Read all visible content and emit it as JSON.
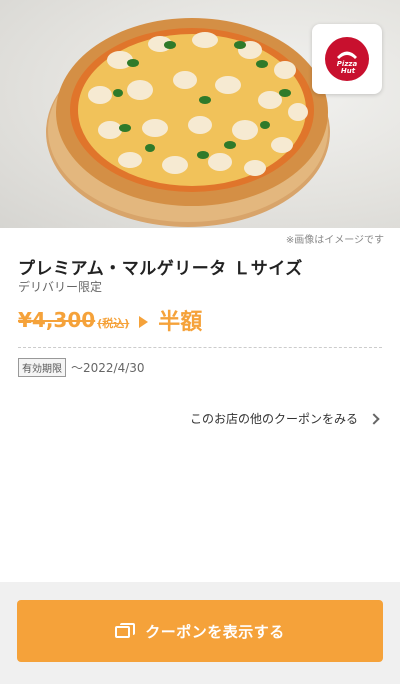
{
  "hero": {
    "image_alt": "Margherita pizza",
    "brand_logo_text": "Pizza Hut"
  },
  "note": "※画像はイメージです",
  "product": {
    "title": "プレミアム・マルゲリータ Ｌサイズ",
    "subtitle": "デリバリー限定",
    "old_price": "¥4,300",
    "tax_note": "(税込)",
    "discount": "半額"
  },
  "expiry": {
    "label": "有効期限",
    "date": "〜2022/4/30"
  },
  "other_coupons_link": "このお店の他のクーポンをみる",
  "cta": {
    "label": "クーポンを表示する"
  },
  "colors": {
    "accent": "#f5a23a",
    "brand_red": "#c8102e"
  }
}
